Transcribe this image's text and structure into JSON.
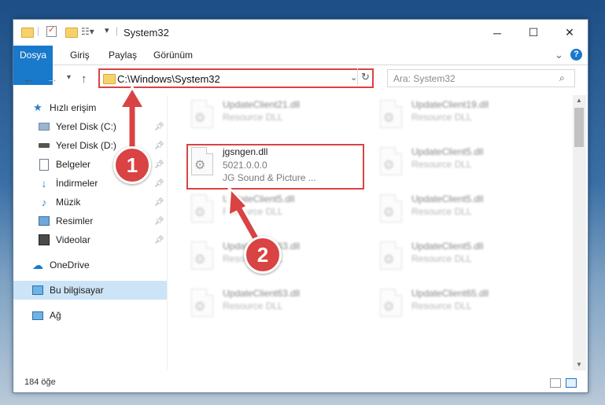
{
  "window": {
    "title": "System32",
    "controls": {
      "minimize": "─",
      "maximize": "☐",
      "close": "✕"
    }
  },
  "ribbon": {
    "tabs": [
      {
        "label": "Dosya"
      },
      {
        "label": "Giriş"
      },
      {
        "label": "Paylaş"
      },
      {
        "label": "Görünüm"
      }
    ],
    "collapse": "⌄",
    "help": "?"
  },
  "address": {
    "path": "C:\\Windows\\System32",
    "search_placeholder": "Ara: System32"
  },
  "sidebar": {
    "quick_access": "Hızlı erişim",
    "items": [
      {
        "label": "Yerel Disk (C:)",
        "icon": "drive-icon"
      },
      {
        "label": "Yerel Disk (D:)",
        "icon": "drive-icon"
      },
      {
        "label": "Belgeler",
        "icon": "documents-icon"
      },
      {
        "label": "İndirmeler",
        "icon": "downloads-icon"
      },
      {
        "label": "Müzik",
        "icon": "music-icon"
      },
      {
        "label": "Resimler",
        "icon": "pictures-icon"
      },
      {
        "label": "Videolar",
        "icon": "videos-icon"
      }
    ],
    "onedrive": "OneDrive",
    "this_pc": "Bu bilgisayar",
    "network": "Ağ"
  },
  "files": {
    "left": [
      {
        "name": "UpdateClient21.dll",
        "desc": "Resource DLL"
      },
      {
        "name": "jgsngen.dll",
        "version": "5021.0.0.0",
        "desc": "JG Sound & Picture ..."
      },
      {
        "name": "UpdateClient5.dll",
        "desc": "Resource DLL"
      },
      {
        "name": "UpdateClient63.dll",
        "desc": "Resource DLL"
      },
      {
        "name": "UpdateClient63.dll",
        "desc": "Resource DLL"
      }
    ],
    "right": [
      {
        "name": "UpdateClient19.dll",
        "desc": "Resource DLL"
      },
      {
        "name": "UpdateClient5.dll",
        "desc": "Resource DLL"
      },
      {
        "name": "UpdateClient5.dll",
        "desc": "Resource DLL"
      },
      {
        "name": "UpdateClient5.dll",
        "desc": "Resource DLL"
      },
      {
        "name": "UpdateClient65.dll",
        "desc": "Resource DLL"
      }
    ]
  },
  "status": {
    "count": "184 öğe"
  },
  "callouts": {
    "one": "1",
    "two": "2"
  },
  "colors": {
    "accent": "#1979ca",
    "highlight": "#d94343",
    "selection": "#cce4f7"
  }
}
